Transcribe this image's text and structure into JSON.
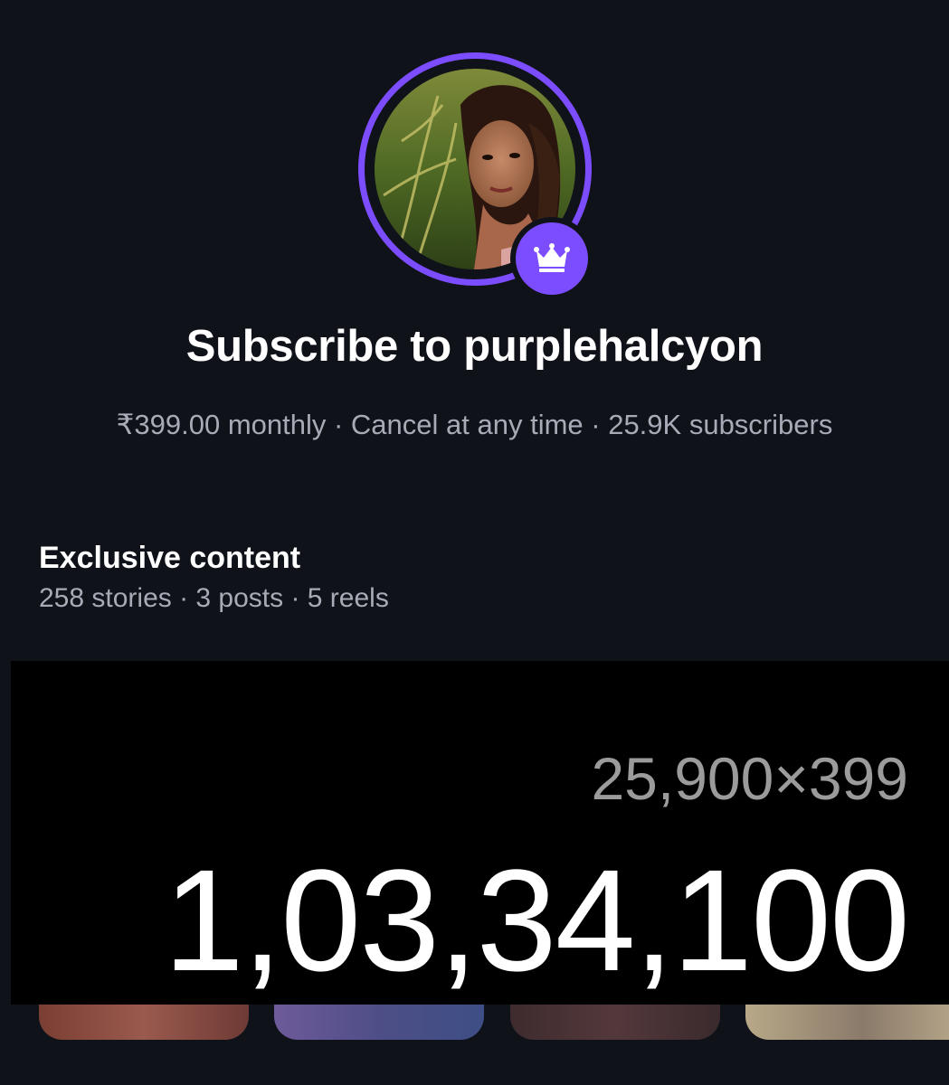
{
  "profile": {
    "avatar_icon": "profile-photo",
    "badge_icon": "crown-icon",
    "ring_color": "#7c4dff"
  },
  "title": "Subscribe to purplehalcyon",
  "meta": "₹399.00 monthly · Cancel at any time · 25.9K subscribers",
  "exclusive": {
    "heading": "Exclusive content",
    "stats": "258 stories · 3 posts · 5 reels"
  },
  "calculator": {
    "expression": "25,900×399",
    "result": "1,03,34,100"
  },
  "colors": {
    "background": "#10121a",
    "accent": "#7c4dff",
    "muted_text": "#a7abb6"
  }
}
